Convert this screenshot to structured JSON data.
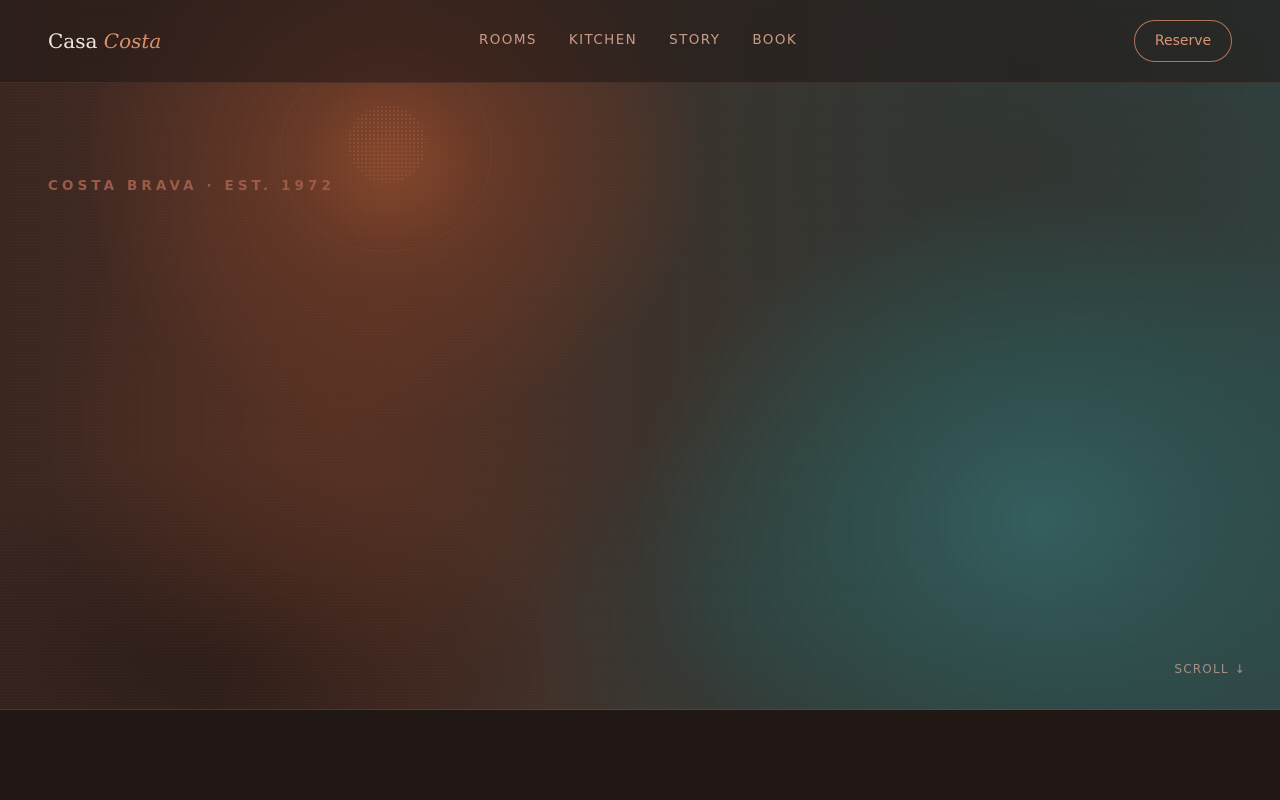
{
  "header": {
    "logo_primary": "Casa",
    "logo_accent": "Costa",
    "nav": [
      {
        "label": "ROOMS"
      },
      {
        "label": "KITCHEN"
      },
      {
        "label": "STORY"
      },
      {
        "label": "BOOK"
      }
    ],
    "reserve_label": "Reserve"
  },
  "hero": {
    "eyebrow": "COSTA BRAVA · EST. 1972",
    "scroll_label": "SCROLL",
    "scroll_arrow": "↓"
  },
  "colors": {
    "background": "#211816",
    "accent": "#d9906a",
    "nav_text": "#c89a88",
    "eyebrow": "#9c5a48",
    "warm_glow": "#7c4028",
    "teal_glow": "#346060"
  },
  "icons": {
    "scroll": "arrow-down-icon"
  }
}
